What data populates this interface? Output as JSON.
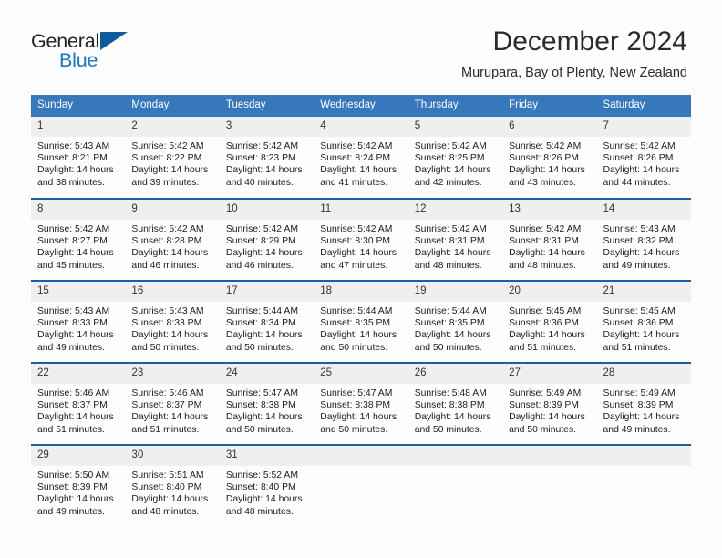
{
  "brand": {
    "name_part1": "General",
    "name_part2": "Blue",
    "logo_icon": "triangle-logo-icon"
  },
  "header": {
    "month_title": "December 2024",
    "location": "Murupara, Bay of Plenty, New Zealand"
  },
  "colors": {
    "header_blue": "#3778bc",
    "row_separator_blue": "#1a5fa0",
    "daynum_band": "#efefef",
    "brand_blue": "#1878c8",
    "logo_blue": "#0d5ca0"
  },
  "weekday_headers": [
    "Sunday",
    "Monday",
    "Tuesday",
    "Wednesday",
    "Thursday",
    "Friday",
    "Saturday"
  ],
  "labels": {
    "sunrise_prefix": "Sunrise:",
    "sunset_prefix": "Sunset:",
    "daylight_prefix": "Daylight:"
  },
  "weeks": [
    [
      {
        "day": "1",
        "sunrise": "Sunrise: 5:43 AM",
        "sunset": "Sunset: 8:21 PM",
        "daylight_line1": "Daylight: 14 hours",
        "daylight_line2": "and 38 minutes."
      },
      {
        "day": "2",
        "sunrise": "Sunrise: 5:42 AM",
        "sunset": "Sunset: 8:22 PM",
        "daylight_line1": "Daylight: 14 hours",
        "daylight_line2": "and 39 minutes."
      },
      {
        "day": "3",
        "sunrise": "Sunrise: 5:42 AM",
        "sunset": "Sunset: 8:23 PM",
        "daylight_line1": "Daylight: 14 hours",
        "daylight_line2": "and 40 minutes."
      },
      {
        "day": "4",
        "sunrise": "Sunrise: 5:42 AM",
        "sunset": "Sunset: 8:24 PM",
        "daylight_line1": "Daylight: 14 hours",
        "daylight_line2": "and 41 minutes."
      },
      {
        "day": "5",
        "sunrise": "Sunrise: 5:42 AM",
        "sunset": "Sunset: 8:25 PM",
        "daylight_line1": "Daylight: 14 hours",
        "daylight_line2": "and 42 minutes."
      },
      {
        "day": "6",
        "sunrise": "Sunrise: 5:42 AM",
        "sunset": "Sunset: 8:26 PM",
        "daylight_line1": "Daylight: 14 hours",
        "daylight_line2": "and 43 minutes."
      },
      {
        "day": "7",
        "sunrise": "Sunrise: 5:42 AM",
        "sunset": "Sunset: 8:26 PM",
        "daylight_line1": "Daylight: 14 hours",
        "daylight_line2": "and 44 minutes."
      }
    ],
    [
      {
        "day": "8",
        "sunrise": "Sunrise: 5:42 AM",
        "sunset": "Sunset: 8:27 PM",
        "daylight_line1": "Daylight: 14 hours",
        "daylight_line2": "and 45 minutes."
      },
      {
        "day": "9",
        "sunrise": "Sunrise: 5:42 AM",
        "sunset": "Sunset: 8:28 PM",
        "daylight_line1": "Daylight: 14 hours",
        "daylight_line2": "and 46 minutes."
      },
      {
        "day": "10",
        "sunrise": "Sunrise: 5:42 AM",
        "sunset": "Sunset: 8:29 PM",
        "daylight_line1": "Daylight: 14 hours",
        "daylight_line2": "and 46 minutes."
      },
      {
        "day": "11",
        "sunrise": "Sunrise: 5:42 AM",
        "sunset": "Sunset: 8:30 PM",
        "daylight_line1": "Daylight: 14 hours",
        "daylight_line2": "and 47 minutes."
      },
      {
        "day": "12",
        "sunrise": "Sunrise: 5:42 AM",
        "sunset": "Sunset: 8:31 PM",
        "daylight_line1": "Daylight: 14 hours",
        "daylight_line2": "and 48 minutes."
      },
      {
        "day": "13",
        "sunrise": "Sunrise: 5:42 AM",
        "sunset": "Sunset: 8:31 PM",
        "daylight_line1": "Daylight: 14 hours",
        "daylight_line2": "and 48 minutes."
      },
      {
        "day": "14",
        "sunrise": "Sunrise: 5:43 AM",
        "sunset": "Sunset: 8:32 PM",
        "daylight_line1": "Daylight: 14 hours",
        "daylight_line2": "and 49 minutes."
      }
    ],
    [
      {
        "day": "15",
        "sunrise": "Sunrise: 5:43 AM",
        "sunset": "Sunset: 8:33 PM",
        "daylight_line1": "Daylight: 14 hours",
        "daylight_line2": "and 49 minutes."
      },
      {
        "day": "16",
        "sunrise": "Sunrise: 5:43 AM",
        "sunset": "Sunset: 8:33 PM",
        "daylight_line1": "Daylight: 14 hours",
        "daylight_line2": "and 50 minutes."
      },
      {
        "day": "17",
        "sunrise": "Sunrise: 5:44 AM",
        "sunset": "Sunset: 8:34 PM",
        "daylight_line1": "Daylight: 14 hours",
        "daylight_line2": "and 50 minutes."
      },
      {
        "day": "18",
        "sunrise": "Sunrise: 5:44 AM",
        "sunset": "Sunset: 8:35 PM",
        "daylight_line1": "Daylight: 14 hours",
        "daylight_line2": "and 50 minutes."
      },
      {
        "day": "19",
        "sunrise": "Sunrise: 5:44 AM",
        "sunset": "Sunset: 8:35 PM",
        "daylight_line1": "Daylight: 14 hours",
        "daylight_line2": "and 50 minutes."
      },
      {
        "day": "20",
        "sunrise": "Sunrise: 5:45 AM",
        "sunset": "Sunset: 8:36 PM",
        "daylight_line1": "Daylight: 14 hours",
        "daylight_line2": "and 51 minutes."
      },
      {
        "day": "21",
        "sunrise": "Sunrise: 5:45 AM",
        "sunset": "Sunset: 8:36 PM",
        "daylight_line1": "Daylight: 14 hours",
        "daylight_line2": "and 51 minutes."
      }
    ],
    [
      {
        "day": "22",
        "sunrise": "Sunrise: 5:46 AM",
        "sunset": "Sunset: 8:37 PM",
        "daylight_line1": "Daylight: 14 hours",
        "daylight_line2": "and 51 minutes."
      },
      {
        "day": "23",
        "sunrise": "Sunrise: 5:46 AM",
        "sunset": "Sunset: 8:37 PM",
        "daylight_line1": "Daylight: 14 hours",
        "daylight_line2": "and 51 minutes."
      },
      {
        "day": "24",
        "sunrise": "Sunrise: 5:47 AM",
        "sunset": "Sunset: 8:38 PM",
        "daylight_line1": "Daylight: 14 hours",
        "daylight_line2": "and 50 minutes."
      },
      {
        "day": "25",
        "sunrise": "Sunrise: 5:47 AM",
        "sunset": "Sunset: 8:38 PM",
        "daylight_line1": "Daylight: 14 hours",
        "daylight_line2": "and 50 minutes."
      },
      {
        "day": "26",
        "sunrise": "Sunrise: 5:48 AM",
        "sunset": "Sunset: 8:38 PM",
        "daylight_line1": "Daylight: 14 hours",
        "daylight_line2": "and 50 minutes."
      },
      {
        "day": "27",
        "sunrise": "Sunrise: 5:49 AM",
        "sunset": "Sunset: 8:39 PM",
        "daylight_line1": "Daylight: 14 hours",
        "daylight_line2": "and 50 minutes."
      },
      {
        "day": "28",
        "sunrise": "Sunrise: 5:49 AM",
        "sunset": "Sunset: 8:39 PM",
        "daylight_line1": "Daylight: 14 hours",
        "daylight_line2": "and 49 minutes."
      }
    ],
    [
      {
        "day": "29",
        "sunrise": "Sunrise: 5:50 AM",
        "sunset": "Sunset: 8:39 PM",
        "daylight_line1": "Daylight: 14 hours",
        "daylight_line2": "and 49 minutes."
      },
      {
        "day": "30",
        "sunrise": "Sunrise: 5:51 AM",
        "sunset": "Sunset: 8:40 PM",
        "daylight_line1": "Daylight: 14 hours",
        "daylight_line2": "and 48 minutes."
      },
      {
        "day": "31",
        "sunrise": "Sunrise: 5:52 AM",
        "sunset": "Sunset: 8:40 PM",
        "daylight_line1": "Daylight: 14 hours",
        "daylight_line2": "and 48 minutes."
      },
      {
        "day": "",
        "sunrise": "",
        "sunset": "",
        "daylight_line1": "",
        "daylight_line2": ""
      },
      {
        "day": "",
        "sunrise": "",
        "sunset": "",
        "daylight_line1": "",
        "daylight_line2": ""
      },
      {
        "day": "",
        "sunrise": "",
        "sunset": "",
        "daylight_line1": "",
        "daylight_line2": ""
      },
      {
        "day": "",
        "sunrise": "",
        "sunset": "",
        "daylight_line1": "",
        "daylight_line2": ""
      }
    ]
  ]
}
